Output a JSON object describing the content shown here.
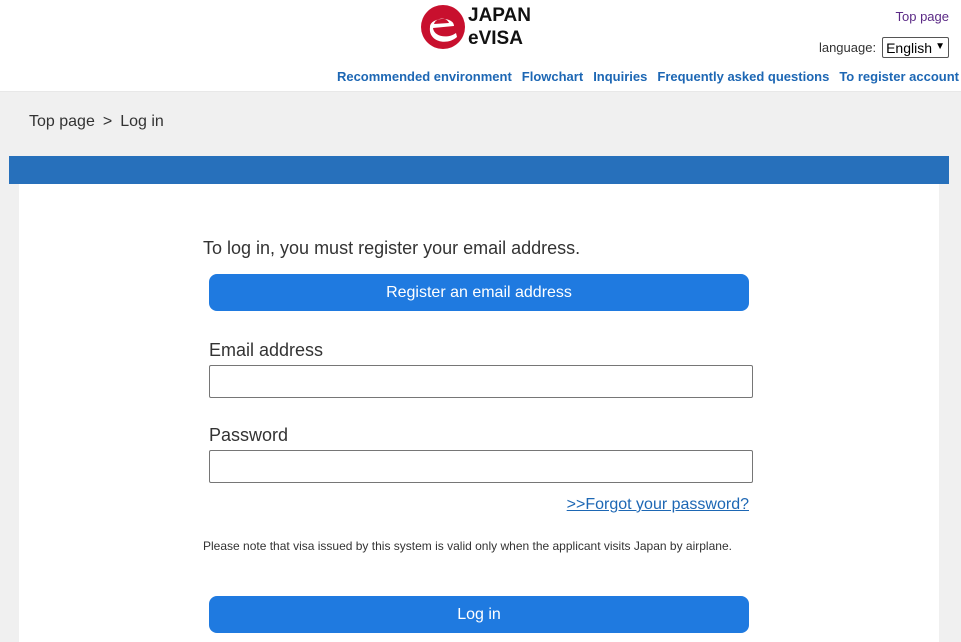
{
  "header": {
    "logo_line1": "JAPAN",
    "logo_line2": "eVISA",
    "top_page_link": "Top page",
    "language_label": "language:",
    "language_selected": "English",
    "nav": [
      "Recommended environment",
      "Flowchart",
      "Inquiries",
      "Frequently asked questions",
      "To register account"
    ]
  },
  "breadcrumb": {
    "home": "Top page",
    "separator": ">",
    "current": "Log in"
  },
  "login": {
    "intro_text": "To log in, you must register your email address.",
    "register_button": "Register an email address",
    "email_label": "Email address",
    "email_value": "",
    "password_label": "Password",
    "password_value": "",
    "forgot_link": ">>Forgot your password?",
    "note": "Please note that visa issued by this system is valid only when the applicant visits Japan by airplane.",
    "login_button": "Log in"
  },
  "colors": {
    "brand_red": "#c8102e",
    "band_blue": "#2770bb",
    "button_blue": "#1f7ae0",
    "link_blue": "#1d67b4",
    "visited_purple": "#5b2a86"
  }
}
